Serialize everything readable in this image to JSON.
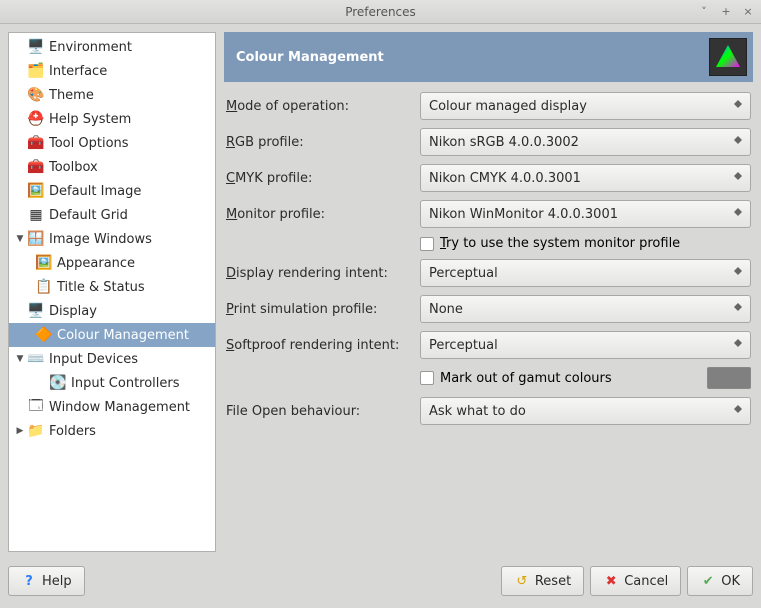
{
  "window": {
    "title": "Preferences"
  },
  "sidebar": {
    "items": [
      {
        "label": "Environment",
        "icon": "🖥️"
      },
      {
        "label": "Interface",
        "icon": "🗂️"
      },
      {
        "label": "Theme",
        "icon": "🎨"
      },
      {
        "label": "Help System",
        "icon": "⛑️"
      },
      {
        "label": "Tool Options",
        "icon": "🧰"
      },
      {
        "label": "Toolbox",
        "icon": "🧰"
      },
      {
        "label": "Default Image",
        "icon": "🖼️"
      },
      {
        "label": "Default Grid",
        "icon": "▦"
      },
      {
        "label": "Image Windows",
        "icon": "🪟",
        "expandable": true,
        "expanded": true
      },
      {
        "label": "Appearance",
        "icon": "🖼️",
        "child": true
      },
      {
        "label": "Title & Status",
        "icon": "📋",
        "child": true
      },
      {
        "label": "Display",
        "icon": "🖥️"
      },
      {
        "label": "Colour Management",
        "icon": "🔶",
        "selected": true,
        "child": true
      },
      {
        "label": "Input Devices",
        "icon": "⌨️",
        "expandable": true,
        "expanded": true
      },
      {
        "label": "Input Controllers",
        "icon": "💽",
        "child": true
      },
      {
        "label": "Window Management",
        "icon": "🗔"
      },
      {
        "label": "Folders",
        "icon": "📁",
        "expandable": true,
        "expanded": false
      }
    ]
  },
  "header": {
    "title": "Colour Management"
  },
  "form": {
    "mode_label": "Mode of operation:",
    "mode_value": "Colour managed display",
    "rgb_label": "RGB profile:",
    "rgb_value": "Nikon sRGB 4.0.0.3002",
    "cmyk_label": "CMYK profile:",
    "cmyk_value": "Nikon CMYK 4.0.0.3001",
    "monitor_label": "Monitor profile:",
    "monitor_value": "Nikon WinMonitor 4.0.0.3001",
    "system_monitor_check": "Try to use the system monitor profile",
    "disp_intent_label": "Display rendering intent:",
    "disp_intent_value": "Perceptual",
    "print_sim_label": "Print simulation profile:",
    "print_sim_value": "None",
    "softproof_label": "Softproof rendering intent:",
    "softproof_value": "Perceptual",
    "gamut_check": "Mark out of gamut colours",
    "fileopen_label": "File Open behaviour:",
    "fileopen_value": "Ask what to do"
  },
  "buttons": {
    "help": "Help",
    "reset": "Reset",
    "cancel": "Cancel",
    "ok": "OK"
  }
}
